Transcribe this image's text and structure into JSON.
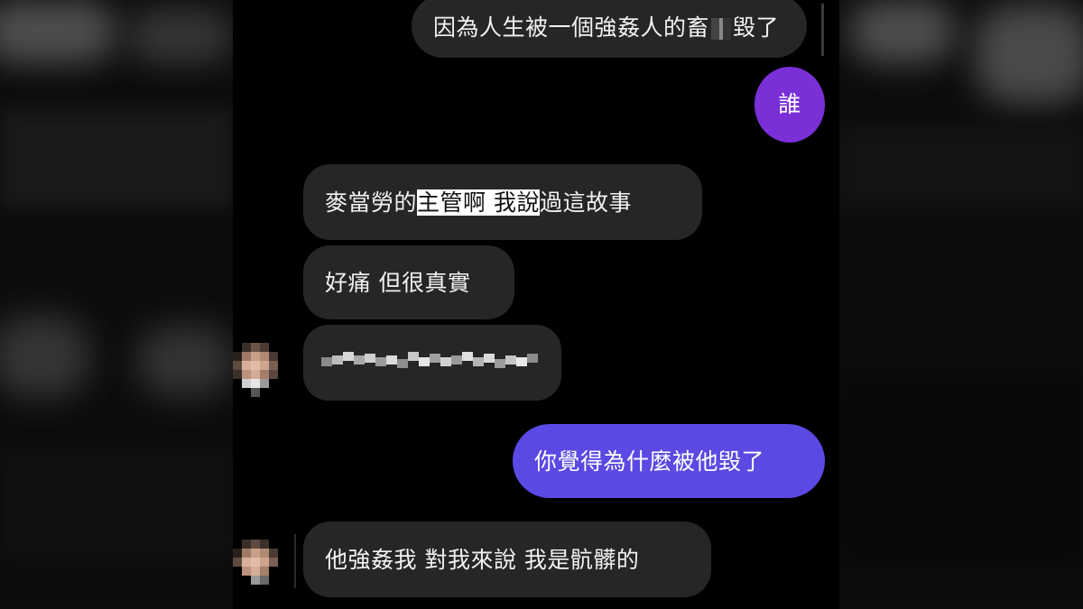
{
  "messages": {
    "m1_text": "因為人生被一個強姦人的畜",
    "m1_tail": "毀了",
    "m2_text": "誰",
    "m3_pre": "麥當勞的",
    "m3_highlight": "主管啊 我說",
    "m3_post": "過這故事",
    "m4_text": "好痛 但很真實",
    "m6_text": "你覺得為什麼被他毀了",
    "m7_text": "他強姦我 對我來說 我是骯髒的"
  },
  "colors": {
    "background": "#000000",
    "incoming_bubble": "#262626",
    "outgoing_blue": "#5b49e3",
    "outgoing_purple": "#7b2fd6",
    "highlight": "#ffffff"
  }
}
